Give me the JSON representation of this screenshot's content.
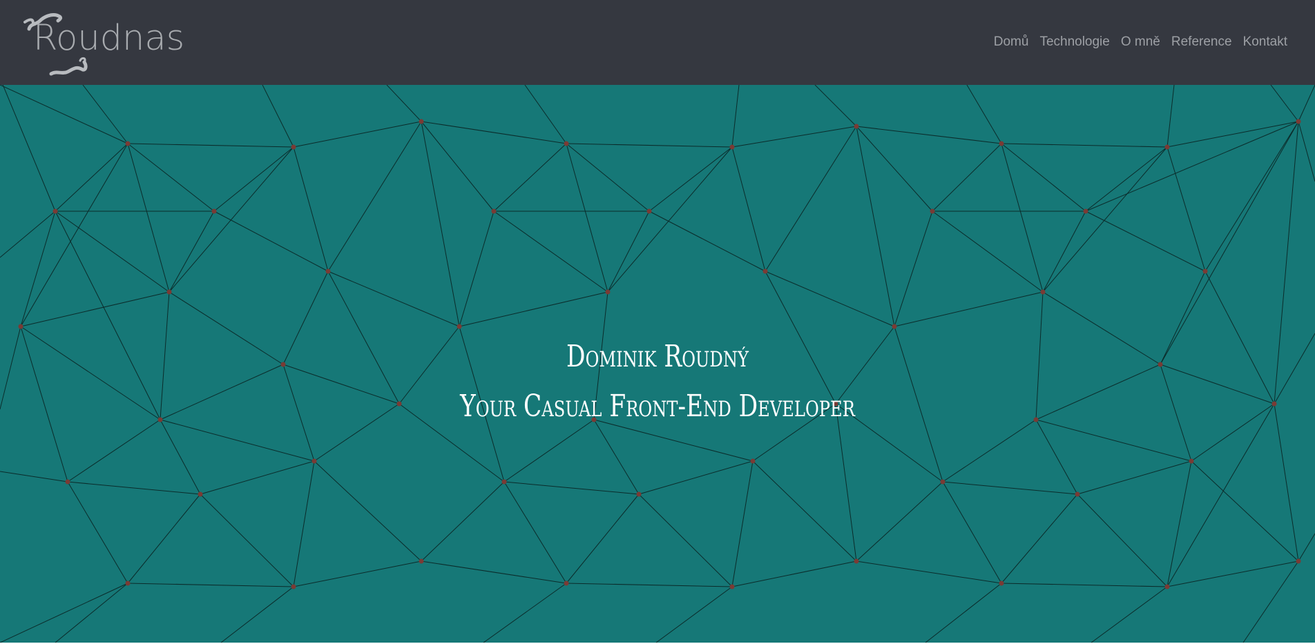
{
  "header": {
    "logo_text": "Roudnas",
    "nav": [
      "Domů",
      "Technologie",
      "O mně",
      "Reference",
      "Kontakt"
    ]
  },
  "hero": {
    "title": "Dominik Roudný",
    "subtitle": "Your Casual Front-End Developer"
  },
  "colors": {
    "topbar": "#353840",
    "hero_bg": "#167877",
    "mesh_line": "#0b2b2a",
    "mesh_point": "#7a3b35",
    "logo": "#a8abaf",
    "nav_text": "#9da0a5"
  },
  "icons": {
    "logo": "map-outline-icon"
  }
}
